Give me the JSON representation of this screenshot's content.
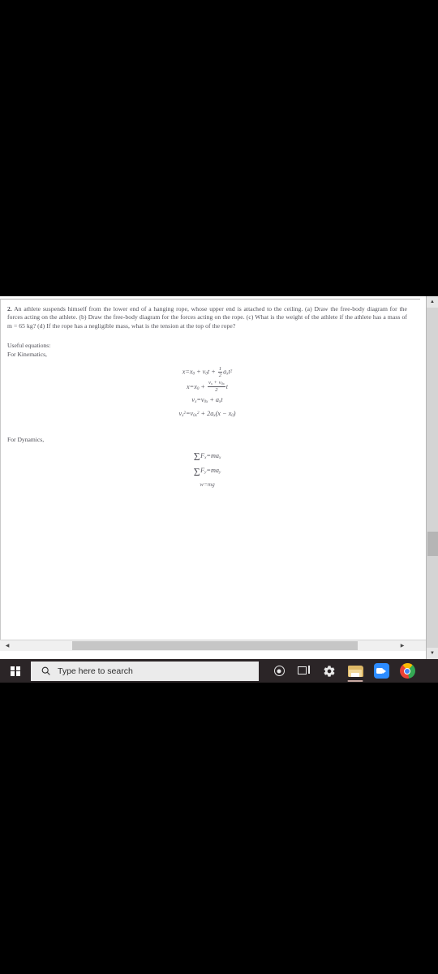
{
  "document": {
    "problem": {
      "number": "2.",
      "text": "An athlete suspends himself from the lower end of a hanging rope, whose upper end is attached to the ceiling. (a) Draw the free-body diagram for the forces acting on the athlete. (b) Draw the free-body diagram for the forces acting on the rope. (c) What is the weight of the athlete if the athlete has a mass of m = 65 kg? (d) If the rope has a negligible mass, what is the tension at the top of the rope?"
    },
    "useful_equations_label": "Useful equations:",
    "kinematics_label": "For Kinematics,",
    "kinematics_equations": [
      "x = x0 + v0*t + (1/2)*ax*t^2",
      "x = x0 + ((vx + v0x)/2)*t",
      "vx = v0x + ax*t",
      "vx^2 = v0x^2 + 2*ax*(x - x0)"
    ],
    "dynamics_label": "For Dynamics,",
    "dynamics_equations": [
      "Sum Fx = m*ax",
      "Sum Fy = m*ay",
      "w = mg"
    ],
    "symbols": {
      "x": "x",
      "x0_sub": "0",
      "v": "v",
      "t": "t",
      "a": "a",
      "x_sub": "x",
      "y_sub": "y",
      "zero_x_sub": "0x",
      "two": "2",
      "one": "1",
      "equals": "=",
      "plus": "+",
      "minus": "−",
      "sigma": "Σ",
      "F": "F",
      "m": "m",
      "w": "w",
      "g": "g",
      "lparen": "(",
      "rparen": ")"
    }
  },
  "scrollbars": {
    "vertical_up_arrow": "▲",
    "vertical_down_arrow": "▼",
    "horizontal_left_arrow": "◀",
    "horizontal_right_arrow": "▶"
  },
  "taskbar": {
    "start_label": "Start",
    "search": {
      "placeholder": "Type here to search",
      "icon": "search-icon"
    },
    "items": [
      {
        "name": "cortana-icon",
        "label": "Cortana"
      },
      {
        "name": "task-view-icon",
        "label": "Task View"
      },
      {
        "name": "settings-gear-icon",
        "label": "Settings"
      },
      {
        "name": "file-explorer-icon",
        "label": "File Explorer",
        "active": true
      },
      {
        "name": "zoom-app-icon",
        "label": "Zoom"
      },
      {
        "name": "chrome-icon",
        "label": "Google Chrome"
      }
    ]
  },
  "colors": {
    "taskbar_bg": "#2b2527",
    "search_bg": "#ebebeb",
    "page_bg": "#ffffff",
    "text": "#4d4d55",
    "folder_accent": "#ddb866",
    "zoom_blue": "#2d8cff",
    "active_underline": "#c8a9a2"
  }
}
